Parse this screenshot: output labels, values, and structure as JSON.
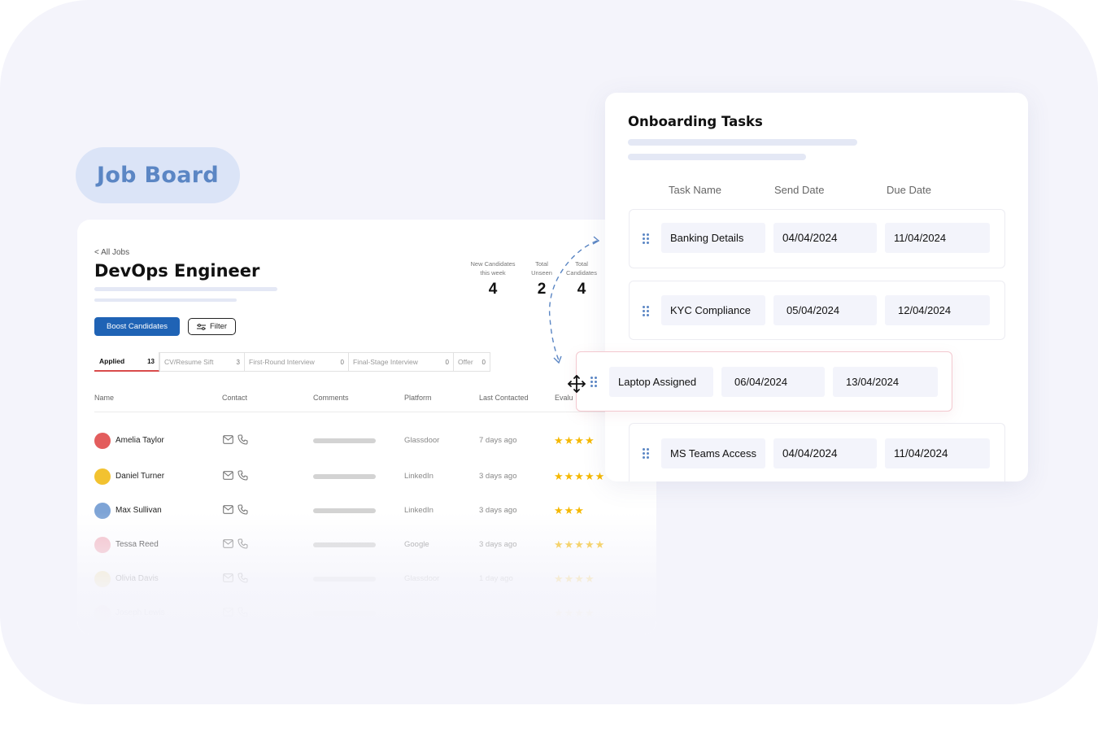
{
  "badge": {
    "label": "Job Board"
  },
  "job": {
    "back_label": "< All Jobs",
    "title": "DevOps Engineer",
    "stats": [
      {
        "label": "New Candidates this week",
        "value": "4"
      },
      {
        "label": "Total Unseen",
        "value": "2"
      },
      {
        "label": "Total Candidates",
        "value": "4"
      }
    ],
    "boost_label": "Boost Candidates",
    "filter_label": "Filter",
    "tabs": [
      {
        "label": "Applied",
        "count": "13"
      },
      {
        "label": "CV/Resume Sift",
        "count": "3"
      },
      {
        "label": "First-Round Interview",
        "count": "0"
      },
      {
        "label": "Final-Stage Interview",
        "count": "0"
      },
      {
        "label": "Offer",
        "count": "0"
      }
    ],
    "columns": [
      "Name",
      "Contact",
      "Comments",
      "Platform",
      "Last Contacted",
      "Evalu"
    ],
    "candidates": [
      {
        "name": "Amelia Taylor",
        "platform": "Glassdoor",
        "last": "7 days ago",
        "stars": "★★★★"
      },
      {
        "name": "Daniel Turner",
        "platform": "LinkedIn",
        "last": "3 days ago",
        "stars": "★★★★★"
      },
      {
        "name": "Max Sullivan",
        "platform": "LinkedIn",
        "last": "3 days ago",
        "stars": "★★★"
      },
      {
        "name": "Tessa Reed",
        "platform": "Google",
        "last": "3 days ago",
        "stars": "★★★★★"
      },
      {
        "name": "Olivia Davis",
        "platform": "Glassdoor",
        "last": "1 day ago",
        "stars": "★★★★"
      },
      {
        "name": "Joseph Lewis",
        "platform": "",
        "last": "",
        "stars": "★★★★"
      }
    ]
  },
  "onboarding": {
    "title": "Onboarding Tasks",
    "columns": [
      "Task Name",
      "Send Date",
      "Due Date"
    ],
    "tasks": [
      {
        "name": "Banking Details",
        "send": "04/04/2024",
        "due": "11/04/2024"
      },
      {
        "name": "KYC Compliance",
        "send": "05/04/2024",
        "due": "12/04/2024"
      },
      {
        "name": "MS Teams Access",
        "send": "04/04/2024",
        "due": "11/04/2024"
      }
    ],
    "dragging": {
      "name": "Laptop Assigned",
      "send": "06/04/2024",
      "due": "13/04/2024"
    }
  },
  "colors": {
    "accent": "#1f63b5",
    "badge_text": "#5b86c4",
    "stars": "#f5b800",
    "active_tab": "#d94b4b"
  },
  "icons": [
    "mail-icon",
    "phone-icon",
    "filter-icon",
    "drag-handle-icon",
    "move-cursor-icon",
    "dashed-arrow-icon"
  ]
}
